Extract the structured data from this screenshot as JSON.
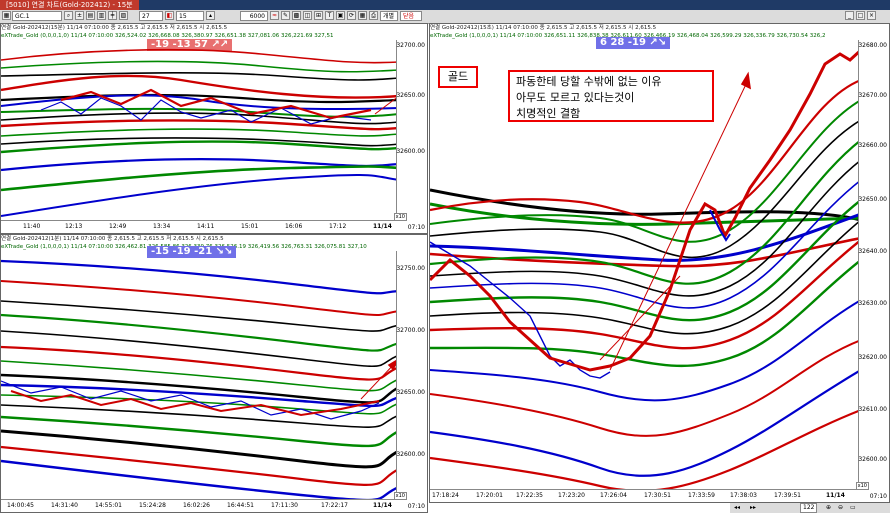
{
  "window": {
    "title": "[5010] 연결 차트(Gold-202412) - 15분"
  },
  "toolbar": {
    "symbol": "GC.1",
    "period_value": "27",
    "interval_value": "15",
    "count_value": "6000",
    "btn_individual": "개별",
    "btn_close": "닫음"
  },
  "pane_top_left": {
    "header1": "연결 Gold-202412(15분) 11/14 07:10:00  종 2,615.5  고 2,615.5  저 2,615.5  시 2,615.5",
    "header2": "eXTrade_Gold (0,0,0,1,0) 11/14 07:10:00 326,524.02 326,668.08 326,380.97 326,651.38 327,081.06 326,221.69 327,51",
    "badge": "-19  -13  57 ↗↗",
    "y_ticks": [
      "32700.00",
      "32650.00",
      "32600.00"
    ],
    "x_ticks": [
      "11:40",
      "12:13",
      "12:49",
      "13:34",
      "14:11",
      "15:01",
      "16:06",
      "17:12",
      "11/14"
    ],
    "x_end": "07:10",
    "scale": "x10"
  },
  "pane_bottom_left": {
    "header1": "연결 Gold-202412(1분) 11/14 07:10:00  종 2,615.5  고 2,615.5  저 2,615.5  시 2,615.5",
    "header2": "eXTrade_Gold (1,0,0,0,1) 11/14 07:10:00 326,462.81 326,585.86 326,339.76 326,526.19 326,419.56 326,763.31 326,075.81 327,10",
    "badge": "-15  -19  -21 ↘↘",
    "y_ticks": [
      "32750.00",
      "32700.00",
      "32650.00",
      "32600.00"
    ],
    "x_ticks": [
      "14:00:45",
      "14:31:40",
      "14:55:01",
      "15:24:28",
      "16:02:26",
      "16:44:51",
      "17:11:30",
      "17:22:17",
      "11/14"
    ],
    "x_end": "07:10",
    "scale": "x10"
  },
  "pane_right": {
    "header1": "연결 Gold-202412(15초) 11/14 07:10:00  종 2,615.5  고 2,615.5  저 2,615.5  시 2,615.5",
    "header2": "eXTrade_Gold (1,0,0,0,1) 11/14 07:10:00 326,651.11 326,838.38 326,611.60 326,466.19 326,468.04 326,599.29 326,336.79 326,730.54 326,2",
    "badge": "6  28  -19 ↗↘",
    "gold_label": "골드",
    "note_lines": [
      "파동한테 당할 수밖에 없는 이유",
      "아무도 모르고 있다는것이",
      "치명적인 결함"
    ],
    "y_ticks": [
      "32680.00",
      "32670.00",
      "32660.00",
      "32650.00",
      "32640.00",
      "32630.00",
      "32620.00",
      "32610.00",
      "32600.00"
    ],
    "x_ticks": [
      "17:18:24",
      "17:20:01",
      "17:22:35",
      "17:23:20",
      "17:26:04",
      "17:30:51",
      "17:33:59",
      "17:38:03",
      "17:39:51",
      "11/14"
    ],
    "x_end": "07:10",
    "scale": "x10",
    "zoom": "122"
  },
  "colors": {
    "up": "#e00000",
    "down": "#0000c0",
    "neutral": "#000000",
    "trend": "#008000",
    "badge_red": "#e87070",
    "badge_blue": "#7070e8"
  }
}
